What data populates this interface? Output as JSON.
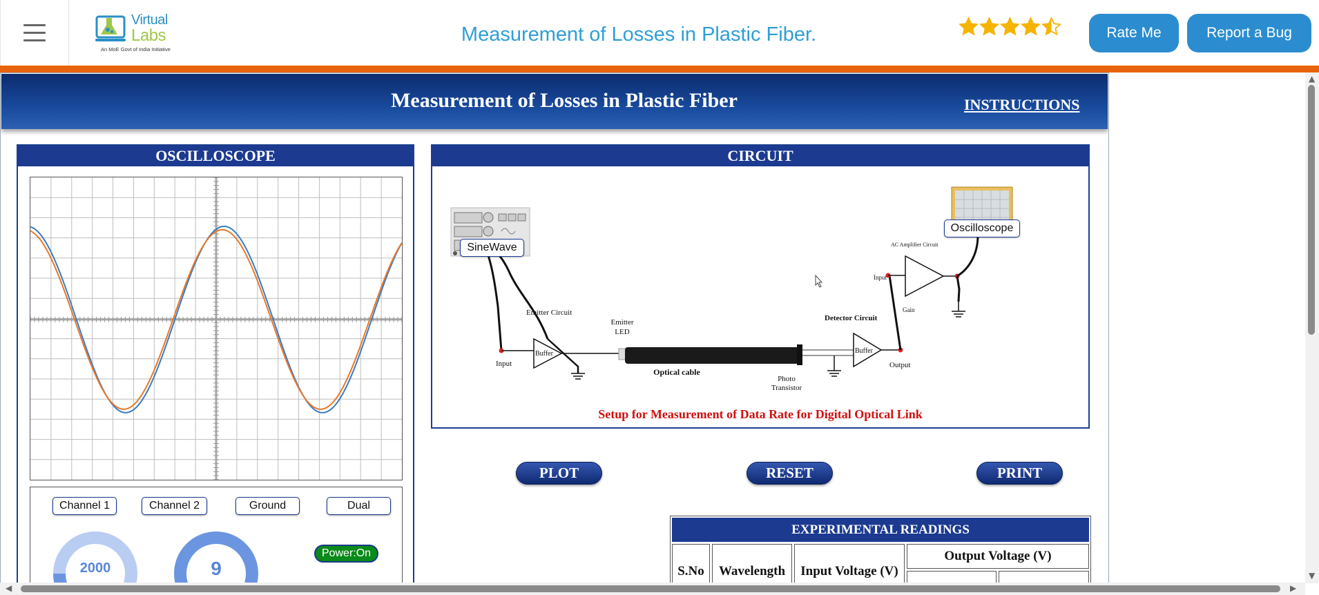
{
  "navbar": {
    "logo_text_a": "Virtual",
    "logo_text_b": "Labs",
    "logo_tagline": "An MoE Govt of India Initiative",
    "title": "Measurement of Losses in Plastic Fiber.",
    "rating": 4.5,
    "rate_label": "Rate Me",
    "bug_label": "Report a Bug",
    "colors": {
      "accent": "#2b8dcf",
      "strip": "#e8640c",
      "star": "#f5b400"
    }
  },
  "sim": {
    "title": "Measurement of Losses in Plastic Fiber",
    "instructions_label": "INSTRUCTIONS"
  },
  "oscilloscope": {
    "title": "OSCILLOSCOPE",
    "channels": [
      "Channel 1",
      "Channel 2",
      "Ground",
      "Dual"
    ],
    "knob_left_value": "2000",
    "knob_right_value": "9",
    "power_label": "Power:On",
    "trace_colors": {
      "channel1": "#3a7cc0",
      "channel2": "#e8782a"
    }
  },
  "circuit": {
    "title": "CIRCUIT",
    "sinewave_label": "SineWave",
    "oscilloscope_label": "Oscilloscope",
    "labels": {
      "emitter_circuit": "Emitter Circuit",
      "input": "Input",
      "buffer": "Buffer",
      "emitter": "Emitter",
      "led": "LED",
      "optical_cable": "Optical cable",
      "photo": "Photo",
      "transistor": "Transistor",
      "detector_circuit": "Detector Circuit",
      "output": "Output",
      "ac_amplifier": "AC Amplifier Circuit",
      "gain": "Gain"
    },
    "caption": "Setup for Measurement of Data Rate for Digital Optical Link"
  },
  "actions": {
    "plot": "PLOT",
    "reset": "RESET",
    "print": "PRINT"
  },
  "readings": {
    "title": "EXPERIMENTAL READINGS",
    "columns": [
      "S.No",
      "Wavelength",
      "Input Voltage (V)",
      "Output Voltage (V)"
    ]
  }
}
